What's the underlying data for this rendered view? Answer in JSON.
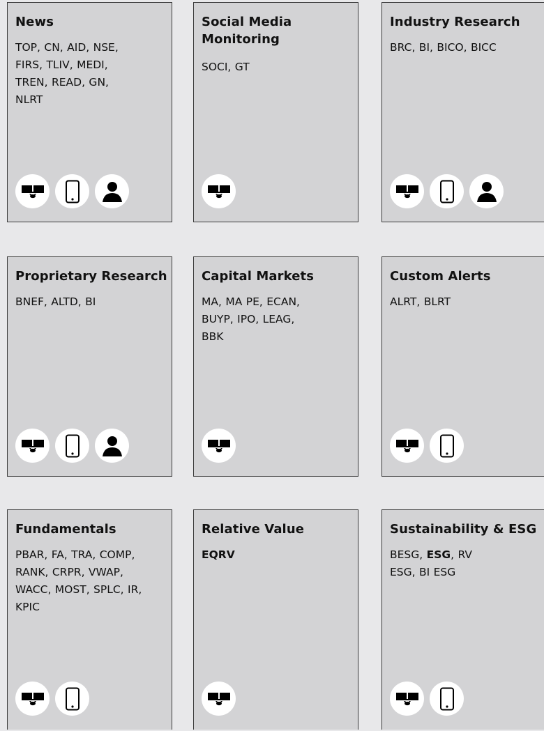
{
  "cards": [
    {
      "title": "News",
      "desc": "TOP, CN, AID, NSE, FIRS, TLIV, MEDI, TREN, READ, GN, NLRT",
      "icons": [
        "terminal-icon",
        "mobile-icon",
        "person-icon"
      ]
    },
    {
      "title": "Social Media\nMonitoring",
      "desc": "SOCI, GT",
      "icons": [
        "terminal-icon"
      ]
    },
    {
      "title": "Industry Research",
      "desc": "BRC, BI, BICO, BICC",
      "icons": [
        "terminal-icon",
        "mobile-icon",
        "person-icon"
      ]
    },
    {
      "title": "Proprietary Research",
      "desc": "BNEF, ALTD, BI",
      "icons": [
        "terminal-icon",
        "mobile-icon",
        "person-icon"
      ]
    },
    {
      "title": "Capital Markets",
      "desc": "MA, MA PE, ECAN, BUYP, IPO, LEAG, BBK",
      "icons": [
        "terminal-icon"
      ]
    },
    {
      "title": "Custom Alerts",
      "desc": "ALRT, BLRT",
      "icons": [
        "terminal-icon",
        "mobile-icon"
      ]
    },
    {
      "title": "Fundamentals",
      "desc": "PBAR, FA, TRA, COMP, RANK, CRPR, VWAP, WACC, MOST, SPLC, IR, KPIC",
      "icons": [
        "terminal-icon",
        "mobile-icon"
      ]
    },
    {
      "title": "Relative Value",
      "desc_bold": "EQRV",
      "icons": [
        "terminal-icon"
      ]
    },
    {
      "title": "Sustainability & ESG",
      "desc_pre": "BESG, ",
      "desc_bold": "ESG",
      "desc_post": ", RV ESG, BI ESG",
      "icons": [
        "terminal-icon",
        "mobile-icon"
      ]
    }
  ]
}
